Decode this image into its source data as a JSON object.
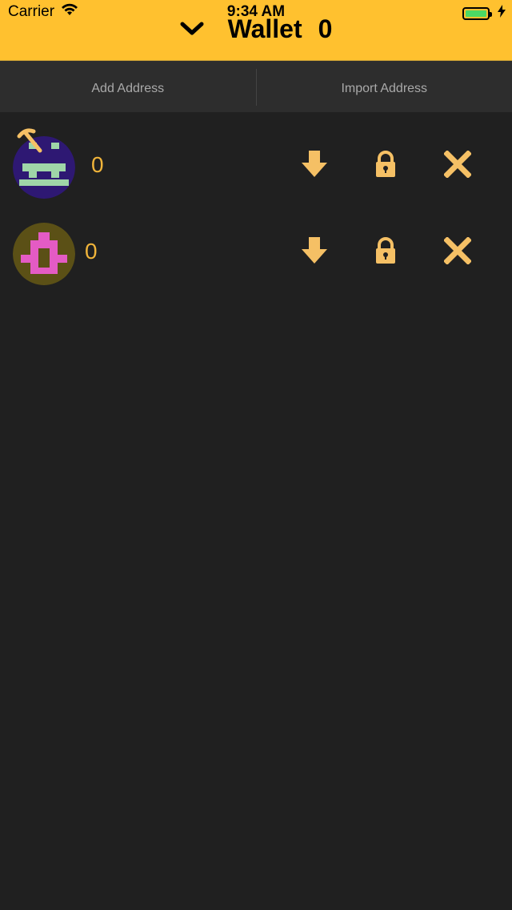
{
  "status_bar": {
    "carrier": "Carrier",
    "time": "9:34 AM"
  },
  "header": {
    "title": "Wallet",
    "balance": "0",
    "accent_color": "#ffc12f"
  },
  "tabs": [
    {
      "label": "Add Address"
    },
    {
      "label": "Import Address"
    }
  ],
  "addresses": [
    {
      "balance": "0",
      "avatar_bg": "#2e1873",
      "avatar_fg": "#9fd6a8",
      "selected": true
    },
    {
      "balance": "0",
      "avatar_bg": "#5b5016",
      "avatar_fg": "#e45bc4",
      "selected": false
    }
  ],
  "icons": {
    "collapse": "chevron-down-icon",
    "receive": "download-arrow-icon",
    "lock": "lock-icon",
    "remove": "close-icon",
    "selected": "pickaxe-icon"
  },
  "colors": {
    "background": "#202020",
    "tabbar": "#2d2d2d",
    "icon": "#f5c065",
    "balance_text": "#f0b43a"
  }
}
